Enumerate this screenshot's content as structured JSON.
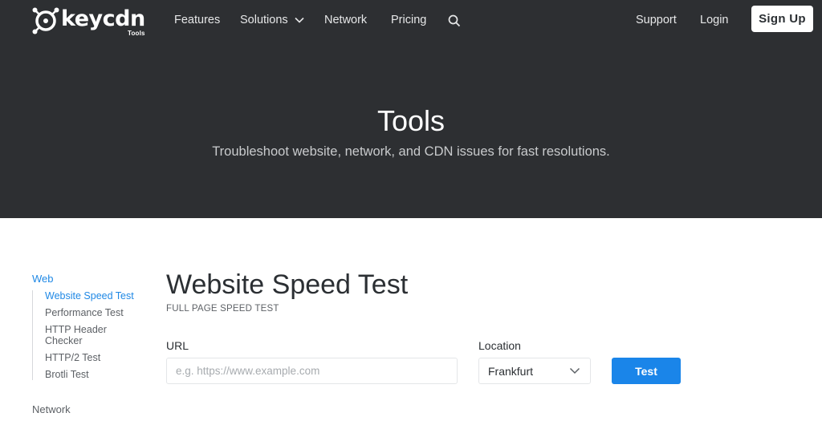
{
  "header": {
    "brand": "keycdn",
    "brand_sub": "Tools",
    "nav": {
      "features": "Features",
      "solutions": "Solutions",
      "network": "Network",
      "pricing": "Pricing",
      "support": "Support",
      "login": "Login",
      "signup": "Sign Up"
    },
    "icons": {
      "logo": "keycdn-logo-icon",
      "solutions_chevron": "chevron-down-icon",
      "search": "search-icon"
    }
  },
  "hero": {
    "title": "Tools",
    "subtitle": "Troubleshoot website, network, and CDN issues for fast resolutions."
  },
  "sidebar": {
    "web_heading": "Web",
    "items": [
      {
        "label": "Website Speed Test",
        "active": true
      },
      {
        "label": "Performance Test",
        "active": false
      },
      {
        "label": "HTTP Header Checker",
        "active": false
      },
      {
        "label": "HTTP/2 Test",
        "active": false
      },
      {
        "label": "Brotli Test",
        "active": false
      }
    ],
    "network_heading": "Network"
  },
  "main": {
    "title": "Website Speed Test",
    "subtitle": "FULL PAGE SPEED TEST",
    "url_label": "URL",
    "url_placeholder": "e.g. https://www.example.com",
    "url_value": "",
    "location_label": "Location",
    "location_value": "Frankfurt",
    "test_button": "Test"
  },
  "colors": {
    "header_bg": "#2d2f32",
    "accent_blue": "#1a85e9",
    "link_blue": "#1f88e5"
  }
}
